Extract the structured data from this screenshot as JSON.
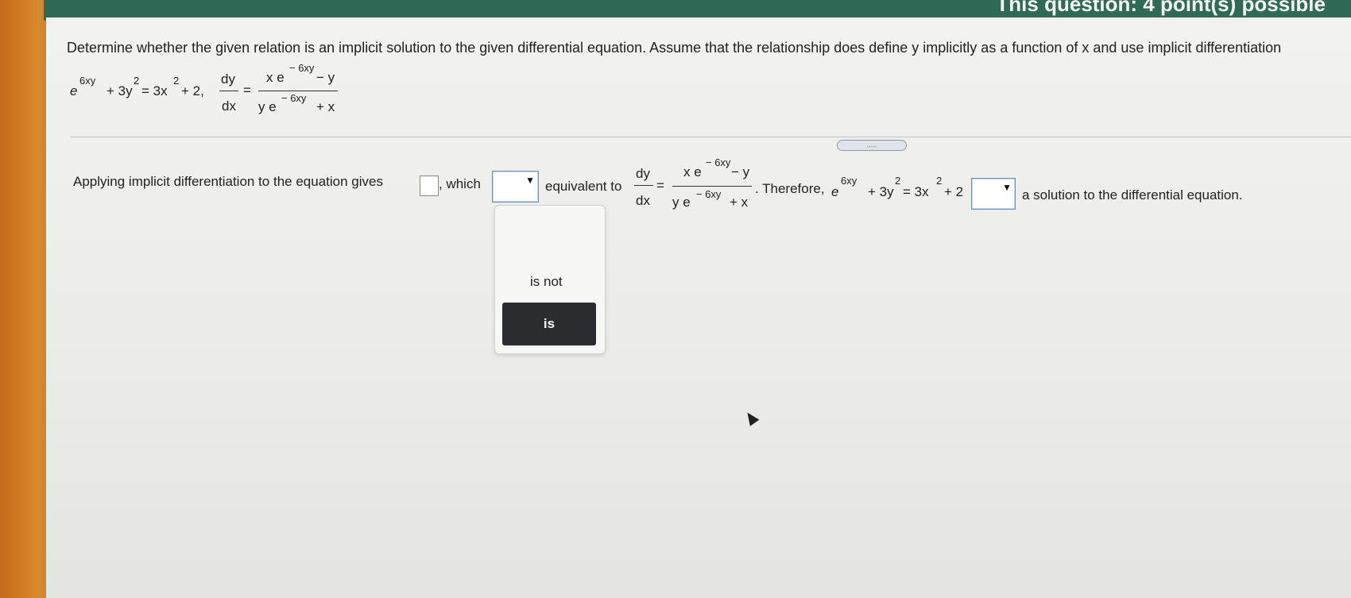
{
  "header": {
    "points_text": "This question: 4 point(s) possible"
  },
  "question": {
    "prompt": "Determine whether the given relation is an implicit solution to the given differential equation. Assume that the relationship does define y implicitly as a function of x and use implicit differentiation",
    "relation": {
      "e": "e",
      "exp": "6xy",
      "term2": "+ 3y",
      "sq": "2",
      "eq": "= 3x",
      "sq2": "2",
      "tail": "+ 2,"
    },
    "ode": {
      "dy": "dy",
      "dx": "dx",
      "eq": "=",
      "num_left": "x e",
      "num_exp": "− 6xy",
      "num_right": "− y",
      "den_left": "y e",
      "den_exp": "− 6xy",
      "den_right": "+ x"
    }
  },
  "divider_button": {
    "label": "....."
  },
  "answer": {
    "prefix": "Applying implicit differentiation to the equation gives",
    "comma_which": ", which",
    "equivalent_to": "equivalent to",
    "therefore": ". Therefore,",
    "rel_e": "e",
    "rel_exp": "6xy",
    "rel_mid": "+ 3y",
    "rel_sq": "2",
    "rel_eq": "= 3x",
    "rel_sq2": "2",
    "rel_tail": "+ 2",
    "suffix": "a solution to the differential equation.",
    "dropdown_arrow": "▼"
  },
  "dropdown": {
    "options": [
      "is not",
      "is"
    ],
    "highlighted": "is"
  }
}
